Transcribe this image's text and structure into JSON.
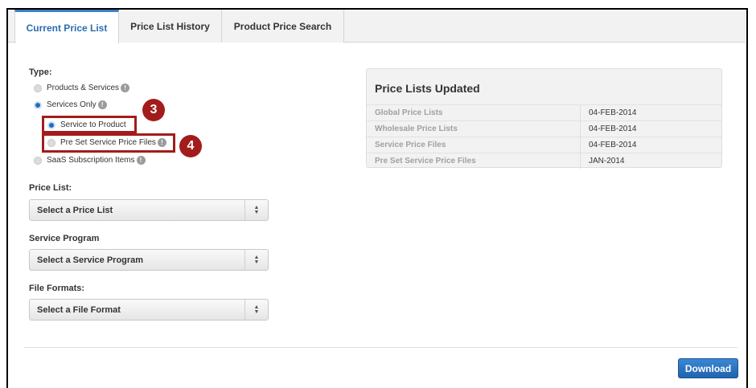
{
  "tabs": [
    {
      "label": "Current Price List",
      "active": true
    },
    {
      "label": "Price List History",
      "active": false
    },
    {
      "label": "Product Price Search",
      "active": false
    }
  ],
  "type_section": {
    "label": "Type:",
    "options": [
      {
        "label": "Products & Services",
        "checked": false
      },
      {
        "label": "Services Only",
        "checked": true
      },
      {
        "label": "Service to Product",
        "checked": true
      },
      {
        "label": "Pre Set Service Price Files",
        "checked": false
      },
      {
        "label": "SaaS Subscription Items",
        "checked": false
      }
    ],
    "info_glyph": "!"
  },
  "callouts": [
    "3",
    "4"
  ],
  "price_list": {
    "label": "Price List:",
    "placeholder": "Select a Price List"
  },
  "service_program": {
    "label": "Service Program",
    "placeholder": "Select a Service Program"
  },
  "file_formats": {
    "label": "File Formats:",
    "placeholder": "Select a File Format"
  },
  "updated_panel": {
    "title": "Price Lists Updated",
    "rows": [
      {
        "name": "Global Price Lists",
        "date": "04-FEB-2014"
      },
      {
        "name": "Wholesale Price Lists",
        "date": "04-FEB-2014"
      },
      {
        "name": "Service Price Files",
        "date": "04-FEB-2014"
      },
      {
        "name": "Pre Set Service Price Files",
        "date": "JAN-2014"
      }
    ]
  },
  "download_label": "Download",
  "colors": {
    "accent": "#1f6fbf",
    "callout": "#a31c1c",
    "tab_active_text": "#2b6cb0"
  }
}
